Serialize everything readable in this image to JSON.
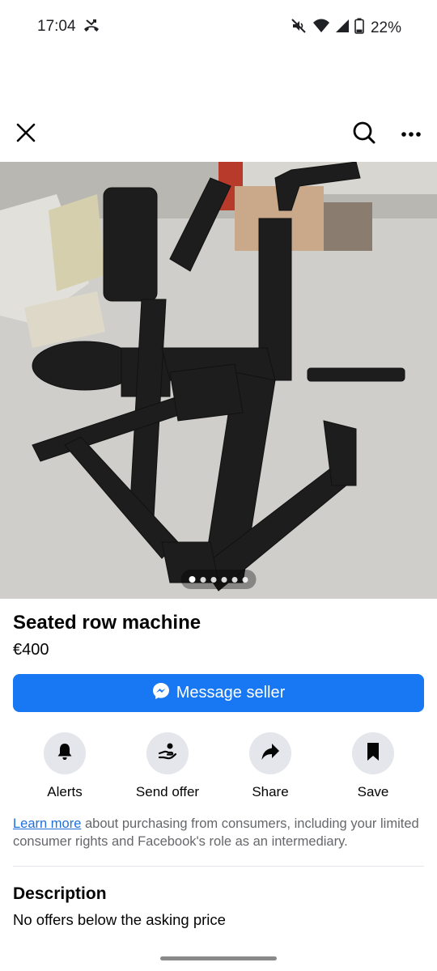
{
  "status_bar": {
    "time": "17:04",
    "battery_text": "22%",
    "icons": [
      "missed-call-icon",
      "mute-icon",
      "wifi-icon",
      "signal-icon",
      "battery-icon"
    ]
  },
  "nav": {
    "icons": [
      "close-icon",
      "search-icon",
      "more-icon"
    ]
  },
  "photo": {
    "description_icon": "product-photo",
    "pager_count": 6,
    "pager_active_index": 0
  },
  "listing": {
    "title": "Seated row machine",
    "price": "€400"
  },
  "message_button": {
    "label": "Message seller",
    "icon": "messenger-icon",
    "color": "#1877f2"
  },
  "actions": [
    {
      "label": "Alerts",
      "icon": "bell-icon"
    },
    {
      "label": "Send offer",
      "icon": "send-offer-icon"
    },
    {
      "label": "Share",
      "icon": "share-arrow-icon"
    },
    {
      "label": "Save",
      "icon": "bookmark-icon"
    }
  ],
  "legal": {
    "link_text": "Learn more",
    "text": " about purchasing from consumers, including your limited consumer rights and Facebook's role as an intermediary."
  },
  "description": {
    "heading": "Description",
    "text": "No offers below the asking price"
  }
}
